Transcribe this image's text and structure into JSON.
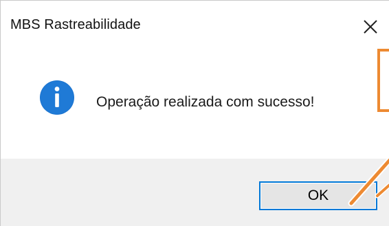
{
  "window": {
    "title": "MBS Rastreabilidade",
    "close_icon": "close-icon"
  },
  "dialog": {
    "icon": "info-icon",
    "message": "Operação realizada com sucesso!"
  },
  "buttons": {
    "ok_label": "OK"
  },
  "colors": {
    "info_icon_fill": "#1a73cf",
    "button_focus_border": "#0078d7",
    "footer_background": "#f0f0f0",
    "annotation_orange": "#ed8a32"
  }
}
